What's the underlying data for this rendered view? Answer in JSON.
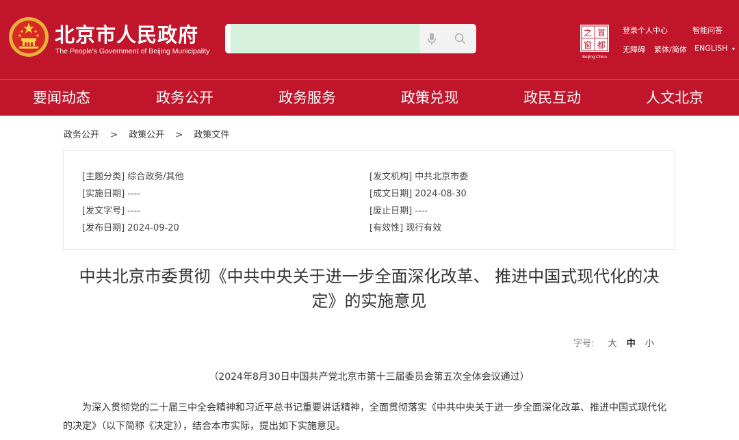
{
  "header": {
    "site_title": "北京市人民政府",
    "site_subtitle": "The People's Government of Beijing Municipality",
    "search": {
      "placeholder": ""
    },
    "capital_logo": {
      "chars": [
        "之",
        "首",
        "窗",
        "都"
      ],
      "caption": "Beijing·China"
    },
    "top_links": {
      "login": "登录个人中心",
      "smart_qa": "智能问答",
      "accessibility": "无障碍",
      "trad_simp": "繁体/简体",
      "english": "ENGLISH",
      "english_arrow": "▾"
    },
    "colors": {
      "brand_red": "#c1152b",
      "search_bg": "#d6f2dc"
    },
    "icons": {
      "emblem": "national-emblem-icon",
      "mic": "microphone-icon",
      "search": "search-icon"
    }
  },
  "nav": {
    "items": [
      "要闻动态",
      "政务公开",
      "政务服务",
      "政策兑现",
      "政民互动",
      "人文北京"
    ]
  },
  "breadcrumb": {
    "items": [
      "政务公开",
      "政策公开",
      "政策文件"
    ],
    "separator": ">"
  },
  "info": {
    "topic": "[主题分类] 综合政务/其他",
    "issuer": "[发文机构] 中共北京市委",
    "effective_date": "[实施日期] ----",
    "created_date": "[成文日期] 2024-08-30",
    "doc_number": "[发文字号] ----",
    "abolish_date": "[废止日期] ----",
    "publish_date": "[发布日期] 2024-09-20",
    "validity": "[有效性] 现行有效"
  },
  "article": {
    "title_line1": "中共北京市委贯彻《中共中央关于进一步全面深化改革、 推进中国式现代化的决",
    "title_line2": "定》的实施意见",
    "font_size_label": "字号:",
    "font_sizes": [
      "大",
      "中",
      "小"
    ],
    "note": "（2024年8月30日中国共产党北京市第十三届委员会第五次全体会议通过）",
    "body": "为深入贯彻党的二十届三中全会精神和习近平总书记重要讲话精神，全面贯彻落实《中共中央关于进一步全面深化改革、推进中国式现代化的决定》（以下简称《决定》），结合本市实际，提出如下实施意见。"
  }
}
